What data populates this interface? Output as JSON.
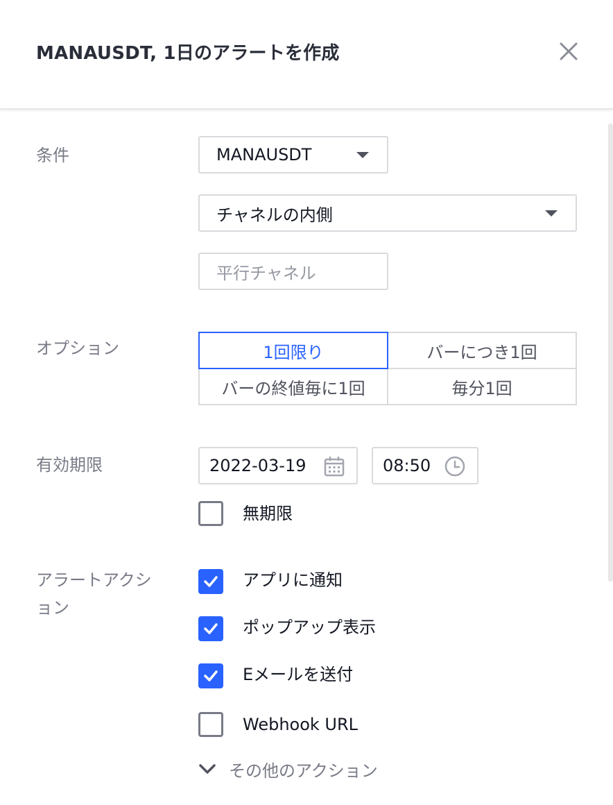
{
  "dialog": {
    "title": "MANAUSDT, 1日のアラートを作成",
    "close_icon": "close-icon"
  },
  "condition": {
    "label": "条件",
    "symbol": "MANAUSDT",
    "operator": "チャネルの内側",
    "target_placeholder": "平行チャネル"
  },
  "options": {
    "label": "オプション",
    "items": [
      {
        "label": "1回限り",
        "selected": true
      },
      {
        "label": "バーにつき1回",
        "selected": false
      },
      {
        "label": "バーの終値毎に1回",
        "selected": false
      },
      {
        "label": "毎分1回",
        "selected": false
      }
    ]
  },
  "expiration": {
    "label": "有効期限",
    "date": "2022-03-19",
    "time": "08:50",
    "open_ended_label": "無期限",
    "open_ended_checked": false
  },
  "actions": {
    "label": "アラートアクション",
    "items": [
      {
        "label": "アプリに通知",
        "checked": true
      },
      {
        "label": "ポップアップ表示",
        "checked": true
      },
      {
        "label": "Eメールを送付",
        "checked": true
      },
      {
        "label": "Webhook URL",
        "checked": false
      }
    ],
    "more_label": "その他のアクション"
  },
  "colors": {
    "accent": "#2962ff",
    "label_gray": "#787b86",
    "border": "#d9dadd"
  }
}
